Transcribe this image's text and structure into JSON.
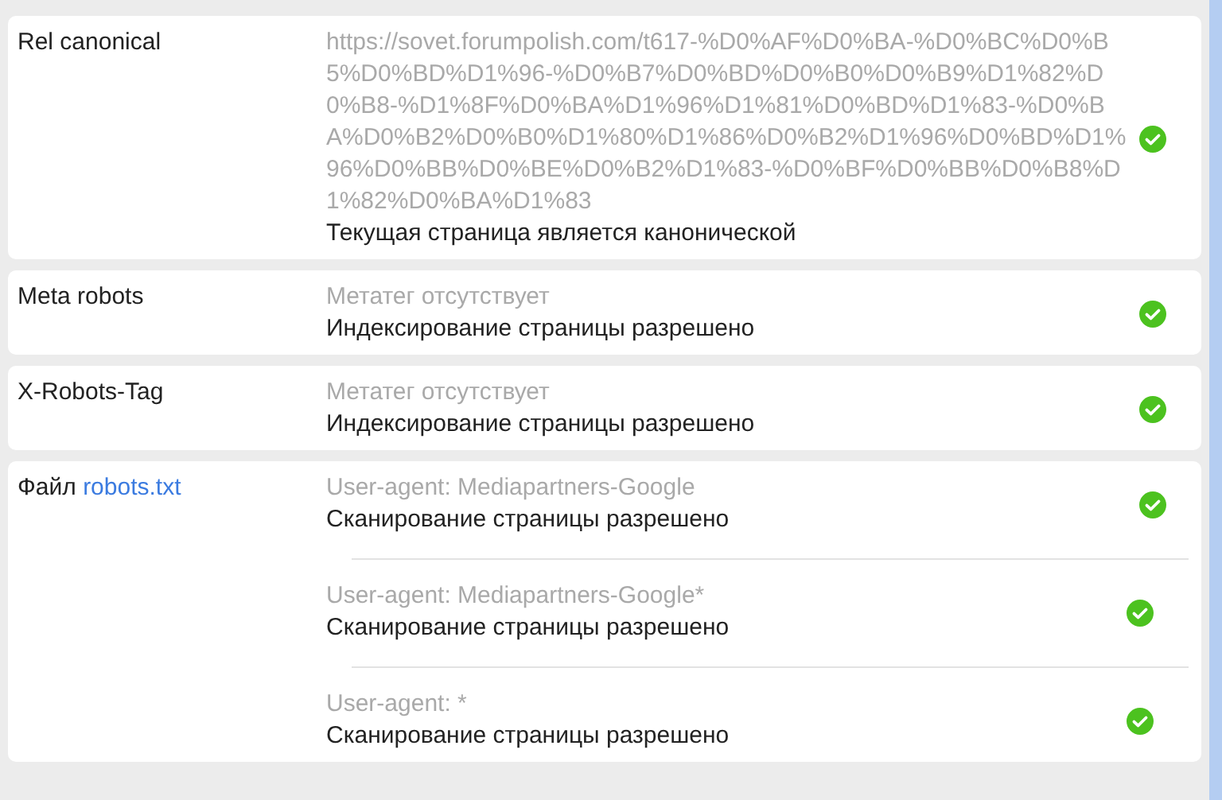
{
  "rows": [
    {
      "label": "Rel canonical",
      "entries": [
        {
          "detail": "https://sovet.forumpolish.com/t617-%D0%AF%D0%BA-%D0%BC%D0%B5%D0%BD%D1%96-%D0%B7%D0%BD%D0%B0%D0%B9%D1%82%D0%B8-%D1%8F%D0%BA%D1%96%D1%81%D0%BD%D1%83-%D0%BA%D0%B2%D0%B0%D1%80%D1%86%D0%B2%D1%96%D0%BD%D1%96%D0%BB%D0%BE%D0%B2%D1%83-%D0%BF%D0%BB%D0%B8%D1%82%D0%BA%D1%83",
          "result": "Текущая страница является канонической",
          "passed": true
        }
      ]
    },
    {
      "label": "Meta robots",
      "entries": [
        {
          "detail": "Метатег отсутствует",
          "result": "Индексирование страницы разрешено",
          "passed": true
        }
      ]
    },
    {
      "label": "X-Robots-Tag",
      "entries": [
        {
          "detail": "Метатег отсутствует",
          "result": "Индексирование страницы разрешено",
          "passed": true
        }
      ]
    },
    {
      "label": "Файл",
      "link": "robots.txt",
      "entries": [
        {
          "detail": "User-agent: Mediapartners-Google",
          "result": "Сканирование страницы разрешено",
          "passed": true
        },
        {
          "detail": "User-agent: Mediapartners-Google*",
          "result": "Сканирование страницы разрешено",
          "passed": true
        },
        {
          "detail": "User-agent: *",
          "result": "Сканирование страницы разрешено",
          "passed": true
        }
      ]
    }
  ]
}
